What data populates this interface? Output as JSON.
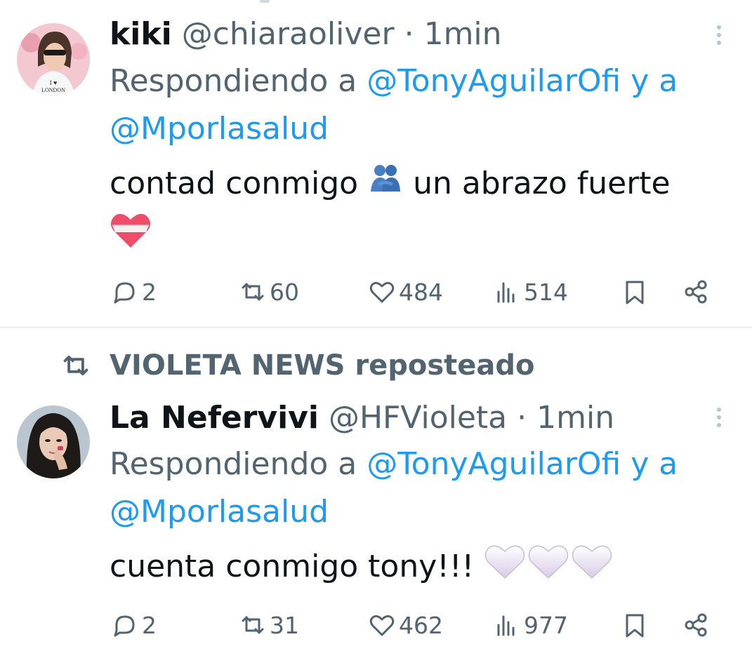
{
  "tweets": [
    {
      "name": "kiki",
      "handle": "@chiaraoliver",
      "separator": "·",
      "time": "1min",
      "replying_prefix": "Respondiendo a",
      "mention1": "@TonyAguilarOfi",
      "joiner": "y a",
      "mention2": "@Mporlasalud",
      "text": "contad conmigo",
      "text2": "un abrazo fuerte",
      "emoji1": "people-hugging",
      "emoji2": "mending-heart",
      "replies": "2",
      "reposts": "60",
      "likes": "484",
      "views": "514"
    },
    {
      "reposted_by": "VIOLETA NEWS reposteado",
      "name": "La Nefervivi",
      "handle": "@HFVioleta",
      "separator": "·",
      "time": "1min",
      "replying_prefix": "Respondiendo a",
      "mention1": "@TonyAguilarOfi",
      "joiner": "y a",
      "mention2": "@Mporlasalud",
      "text": "cuenta conmigo tony!!!",
      "emoji1": "white-heart",
      "replies": "2",
      "reposts": "31",
      "likes": "462",
      "views": "977"
    }
  ],
  "colors": {
    "text": "#0f1419",
    "secondary": "#536471",
    "link": "#1d9bf0",
    "divider": "#eff3f4"
  }
}
